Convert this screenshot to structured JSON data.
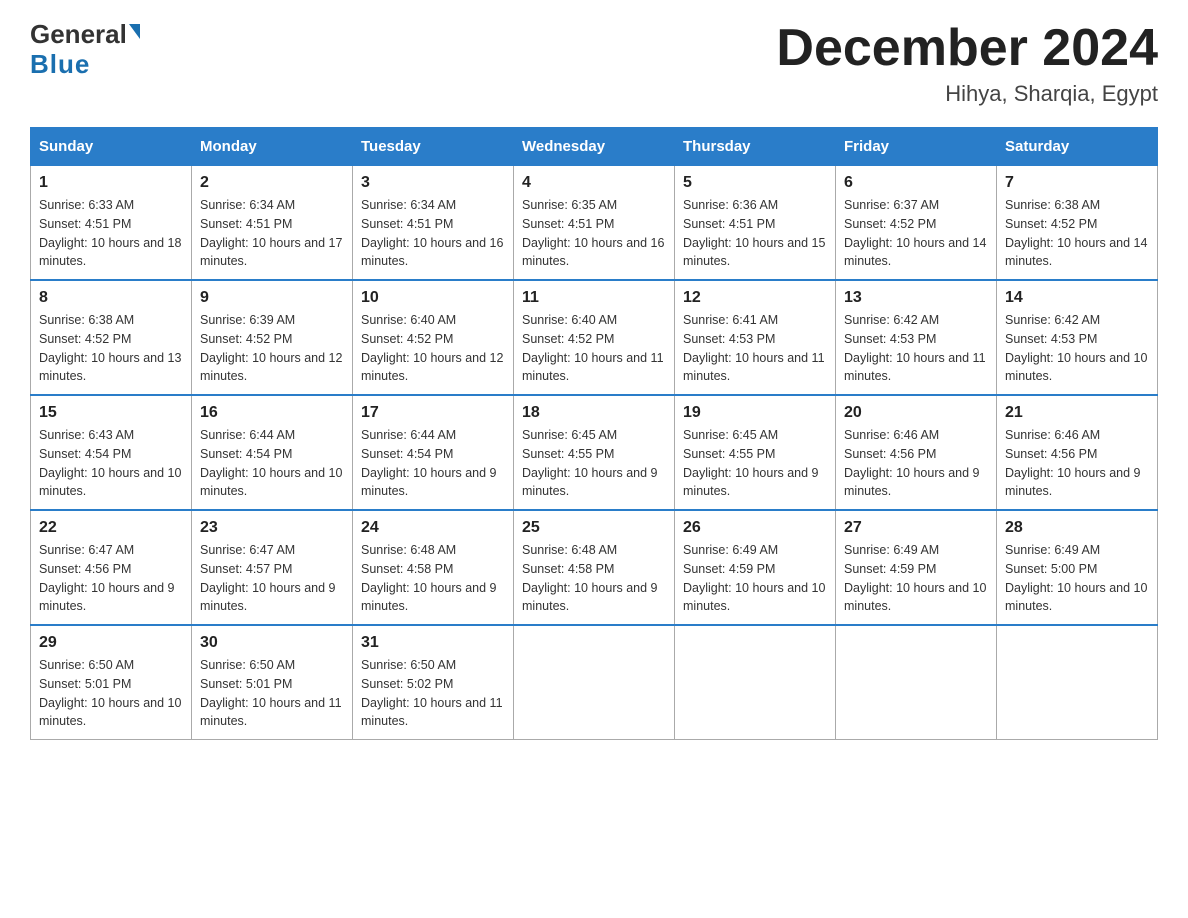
{
  "header": {
    "logo_line1": "General",
    "logo_line2": "Blue",
    "title": "December 2024",
    "subtitle": "Hihya, Sharqia, Egypt"
  },
  "days_of_week": [
    "Sunday",
    "Monday",
    "Tuesday",
    "Wednesday",
    "Thursday",
    "Friday",
    "Saturday"
  ],
  "weeks": [
    [
      {
        "day": "1",
        "sunrise": "6:33 AM",
        "sunset": "4:51 PM",
        "daylight": "10 hours and 18 minutes."
      },
      {
        "day": "2",
        "sunrise": "6:34 AM",
        "sunset": "4:51 PM",
        "daylight": "10 hours and 17 minutes."
      },
      {
        "day": "3",
        "sunrise": "6:34 AM",
        "sunset": "4:51 PM",
        "daylight": "10 hours and 16 minutes."
      },
      {
        "day": "4",
        "sunrise": "6:35 AM",
        "sunset": "4:51 PM",
        "daylight": "10 hours and 16 minutes."
      },
      {
        "day": "5",
        "sunrise": "6:36 AM",
        "sunset": "4:51 PM",
        "daylight": "10 hours and 15 minutes."
      },
      {
        "day": "6",
        "sunrise": "6:37 AM",
        "sunset": "4:52 PM",
        "daylight": "10 hours and 14 minutes."
      },
      {
        "day": "7",
        "sunrise": "6:38 AM",
        "sunset": "4:52 PM",
        "daylight": "10 hours and 14 minutes."
      }
    ],
    [
      {
        "day": "8",
        "sunrise": "6:38 AM",
        "sunset": "4:52 PM",
        "daylight": "10 hours and 13 minutes."
      },
      {
        "day": "9",
        "sunrise": "6:39 AM",
        "sunset": "4:52 PM",
        "daylight": "10 hours and 12 minutes."
      },
      {
        "day": "10",
        "sunrise": "6:40 AM",
        "sunset": "4:52 PM",
        "daylight": "10 hours and 12 minutes."
      },
      {
        "day": "11",
        "sunrise": "6:40 AM",
        "sunset": "4:52 PM",
        "daylight": "10 hours and 11 minutes."
      },
      {
        "day": "12",
        "sunrise": "6:41 AM",
        "sunset": "4:53 PM",
        "daylight": "10 hours and 11 minutes."
      },
      {
        "day": "13",
        "sunrise": "6:42 AM",
        "sunset": "4:53 PM",
        "daylight": "10 hours and 11 minutes."
      },
      {
        "day": "14",
        "sunrise": "6:42 AM",
        "sunset": "4:53 PM",
        "daylight": "10 hours and 10 minutes."
      }
    ],
    [
      {
        "day": "15",
        "sunrise": "6:43 AM",
        "sunset": "4:54 PM",
        "daylight": "10 hours and 10 minutes."
      },
      {
        "day": "16",
        "sunrise": "6:44 AM",
        "sunset": "4:54 PM",
        "daylight": "10 hours and 10 minutes."
      },
      {
        "day": "17",
        "sunrise": "6:44 AM",
        "sunset": "4:54 PM",
        "daylight": "10 hours and 9 minutes."
      },
      {
        "day": "18",
        "sunrise": "6:45 AM",
        "sunset": "4:55 PM",
        "daylight": "10 hours and 9 minutes."
      },
      {
        "day": "19",
        "sunrise": "6:45 AM",
        "sunset": "4:55 PM",
        "daylight": "10 hours and 9 minutes."
      },
      {
        "day": "20",
        "sunrise": "6:46 AM",
        "sunset": "4:56 PM",
        "daylight": "10 hours and 9 minutes."
      },
      {
        "day": "21",
        "sunrise": "6:46 AM",
        "sunset": "4:56 PM",
        "daylight": "10 hours and 9 minutes."
      }
    ],
    [
      {
        "day": "22",
        "sunrise": "6:47 AM",
        "sunset": "4:56 PM",
        "daylight": "10 hours and 9 minutes."
      },
      {
        "day": "23",
        "sunrise": "6:47 AM",
        "sunset": "4:57 PM",
        "daylight": "10 hours and 9 minutes."
      },
      {
        "day": "24",
        "sunrise": "6:48 AM",
        "sunset": "4:58 PM",
        "daylight": "10 hours and 9 minutes."
      },
      {
        "day": "25",
        "sunrise": "6:48 AM",
        "sunset": "4:58 PM",
        "daylight": "10 hours and 9 minutes."
      },
      {
        "day": "26",
        "sunrise": "6:49 AM",
        "sunset": "4:59 PM",
        "daylight": "10 hours and 10 minutes."
      },
      {
        "day": "27",
        "sunrise": "6:49 AM",
        "sunset": "4:59 PM",
        "daylight": "10 hours and 10 minutes."
      },
      {
        "day": "28",
        "sunrise": "6:49 AM",
        "sunset": "5:00 PM",
        "daylight": "10 hours and 10 minutes."
      }
    ],
    [
      {
        "day": "29",
        "sunrise": "6:50 AM",
        "sunset": "5:01 PM",
        "daylight": "10 hours and 10 minutes."
      },
      {
        "day": "30",
        "sunrise": "6:50 AM",
        "sunset": "5:01 PM",
        "daylight": "10 hours and 11 minutes."
      },
      {
        "day": "31",
        "sunrise": "6:50 AM",
        "sunset": "5:02 PM",
        "daylight": "10 hours and 11 minutes."
      },
      null,
      null,
      null,
      null
    ]
  ]
}
